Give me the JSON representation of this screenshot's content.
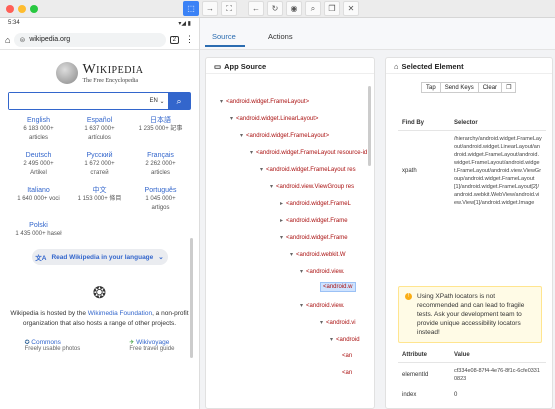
{
  "device": {
    "status_time": "5:34",
    "status_icons": "▾◢ ▮",
    "url": "wikipedia.org",
    "tab_count": "2",
    "wiki_name": "Wikipedia",
    "wiki_tagline": "The Free Encyclopedia",
    "search_lang": "EN",
    "languages": [
      {
        "name": "English",
        "count": "6 183 000+",
        "unit": "articles"
      },
      {
        "name": "Español",
        "count": "1 637 000+",
        "unit": "artículos"
      },
      {
        "name": "日本語",
        "count": "1 235 000+ 記事",
        "unit": ""
      },
      {
        "name": "Deutsch",
        "count": "2 495 000+",
        "unit": "Artikel"
      },
      {
        "name": "Русский",
        "count": "1 672 000+",
        "unit": "статей"
      },
      {
        "name": "Français",
        "count": "2 262 000+",
        "unit": "articles"
      },
      {
        "name": "Italiano",
        "count": "1 640 000+ voci",
        "unit": ""
      },
      {
        "name": "中文",
        "count": "1 153 000+ 條目",
        "unit": ""
      },
      {
        "name": "Português",
        "count": "1 045 000+",
        "unit": "artigos"
      },
      {
        "name": "Polski",
        "count": "1 435 000+ haseł",
        "unit": ""
      }
    ],
    "read_button": "Read Wikipedia in your language",
    "hosted_prefix": "Wikipedia is hosted by the ",
    "hosted_link": "Wikimedia Foundation",
    "hosted_suffix": ", a non-profit organization that also hosts a range of other projects.",
    "sister": [
      {
        "name": "Commons",
        "desc": "Freely usable photos"
      },
      {
        "name": "Wikivoyage",
        "desc": "Free travel guide"
      }
    ]
  },
  "tabs": {
    "source": "Source",
    "actions": "Actions"
  },
  "app_source": {
    "title": "App Source",
    "nodes": [
      "<android.widget.FrameLayout>",
      "<android.widget.LinearLayout>",
      "<android.widget.FrameLayout>",
      "<android.widget.FrameLayout resource-id",
      "<android.widget.FrameLayout res",
      "<android.view.ViewGroup res",
      "<android.widget.FrameL",
      "<android.widget.Frame",
      "<android.widget.Frame",
      "<android.webkit.W",
      "<android.view.",
      "<android.w",
      "<android.view.",
      "<android.vi",
      "<android",
      "<an",
      "<an"
    ]
  },
  "selected": {
    "title": "Selected Element",
    "buttons": [
      "Tap",
      "Send Keys",
      "Clear"
    ],
    "col_find_by": "Find By",
    "col_selector": "Selector",
    "xpath_label": "xpath",
    "xpath_value": "/hierarchy/android.widget.FrameLayout/android.widget.LinearLayout/android.widget.FrameLayout/android.widget.FrameLayout/android.widget.FrameLayout/android.view.ViewGroup/android.widget.FrameLayout[1]/android.widget.FrameLayout[2]/android.webkit.WebView/android.view.View[1]/android.widget.Image",
    "warning": "Using XPath locators is not recommended and can lead to fragile tests. Ask your development team to provide unique accessibility locators instead!",
    "col_attribute": "Attribute",
    "col_value": "Value",
    "attrs": [
      {
        "name": "elementId",
        "value": "cf334e08-87f4-4e76-8f1c-6cfe03310823"
      },
      {
        "name": "index",
        "value": "0"
      }
    ]
  },
  "colors": {
    "accent": "#3b82f6",
    "link": "#3366cc",
    "node": "#aa1111"
  }
}
